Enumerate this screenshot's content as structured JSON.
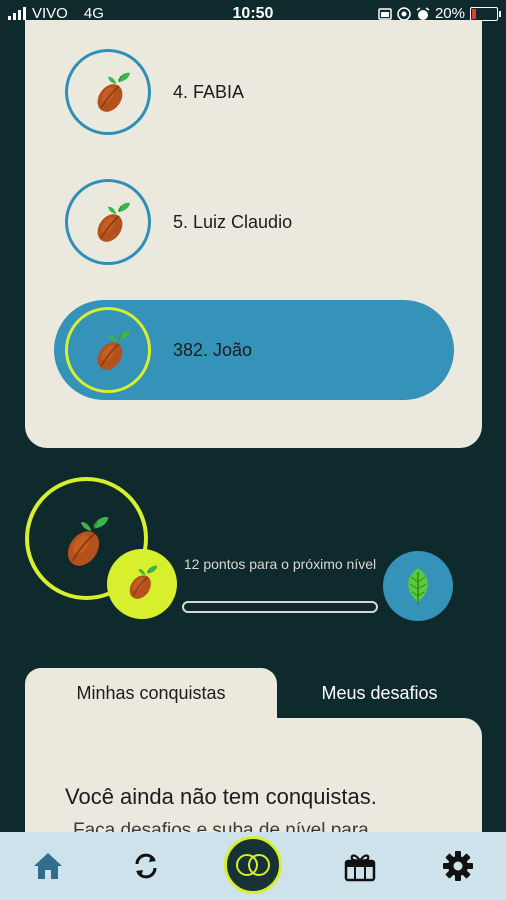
{
  "status_bar": {
    "carrier": "VIVO",
    "network": "4G",
    "time": "10:50",
    "battery": "20%",
    "icons": [
      "signal-icon",
      "cast-icon",
      "do-not-disturb-icon",
      "alarm-icon",
      "battery-icon"
    ]
  },
  "ranking": {
    "rows": [
      {
        "label": "4. FABIA",
        "active": false
      },
      {
        "label": "5. Luiz Claudio",
        "active": false
      },
      {
        "label": "382. João",
        "active": true
      }
    ]
  },
  "level": {
    "progress_text": "12 pontos para o próximo nível",
    "progress_fraction": 0.0,
    "current_level_icon": "cocoa-bean-icon",
    "next_level_icon": "leaf-icon"
  },
  "tabs": [
    {
      "label": "Minhas conquistas",
      "active": true
    },
    {
      "label": "Meus desafios",
      "active": false
    }
  ],
  "empty_state": {
    "title": "Você ainda não tem conquistas.",
    "subtitle": "Faça desafios e suba de nível para"
  },
  "nav": {
    "items": [
      "home-icon",
      "sync-icon",
      "achievements-icon",
      "rewards-icon",
      "settings-icon"
    ]
  },
  "colors": {
    "background": "#0f2a2c",
    "card": "#ebe9de",
    "accent_blue": "#3592b8",
    "accent_lime": "#d8ef2e"
  }
}
